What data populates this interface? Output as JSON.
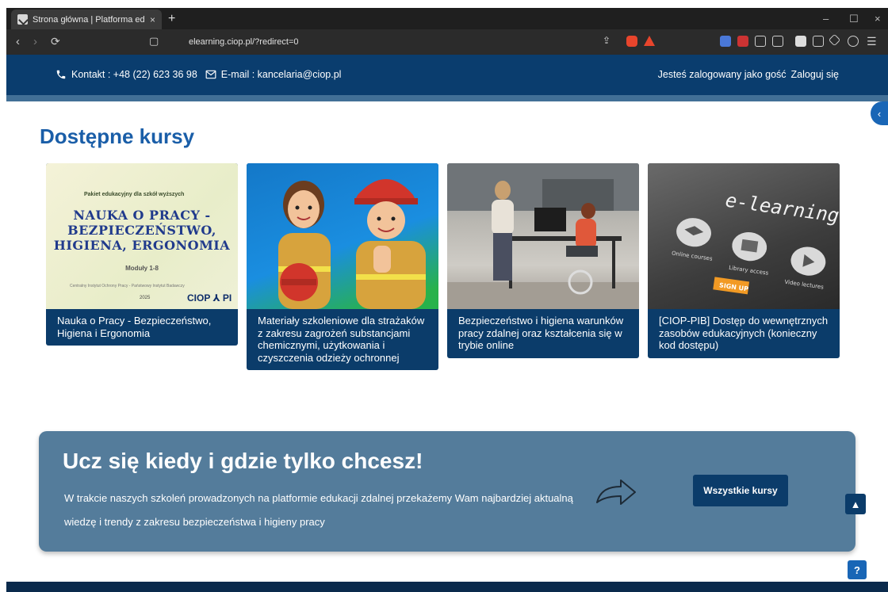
{
  "browser": {
    "tab_title": "Strona główna | Platforma edukac",
    "tab_close": "×",
    "new_tab": "+",
    "url": "elearning.ciop.pl/?redirect=0",
    "window_controls": [
      "–",
      "☐",
      "×"
    ]
  },
  "topbar": {
    "contact": "Kontakt : +48 (22) 623 36 98",
    "email": "E-mail : kancelaria@ciop.pl",
    "user_status": "Jesteś zalogowany jako gość",
    "login_link": "Zaloguj się"
  },
  "main": {
    "heading": "Dostępne kursy",
    "courses": [
      {
        "title": "Nauka o Pracy - Bezpieczeństwo, Higiena i Ergonomia"
      },
      {
        "title": "Materiały szkoleniowe dla strażaków z zakresu zagrożeń substancjami chemicznymi, użytkowania i czyszczenia odzieży ochronnej"
      },
      {
        "title": "Bezpieczeństwo i higiena warunków pracy zdalnej oraz kształcenia się w trybie online"
      },
      {
        "title": "[CIOP-PIB] Dostęp do wewnętrznych zasobów edukacyjnych (konieczny kod dostępu)"
      }
    ],
    "course1_image": {
      "kicker": "Pakiet edukacyjny dla szkół wyższych",
      "line1": "NAUKA O PRACY -",
      "line2": "BEZPIECZEŃSTWO,",
      "line3": "HIGIENA, ERGONOMIA",
      "modules": "Moduły 1-8",
      "publisher": "Centralny Instytut Ochrony Pracy - Państwowy Instytut Badawczy",
      "year": "2025",
      "logo": "CIOP ⅄ PI"
    },
    "course4_image": {
      "title": "e-learning",
      "online": "Online courses",
      "library": "Library access",
      "video": "Video lectures",
      "signup": "SIGN UP"
    }
  },
  "banner": {
    "heading": "Ucz się kiedy i gdzie tylko chcesz!",
    "text": "W trakcie naszych szkoleń prowadzonych na platformie edukacji zdalnej przekażemy Wam najbardziej aktualną wiedzę i trendy z zakresu bezpieczeństwa i higieny pracy",
    "button": "Wszystkie kursy"
  },
  "floating": {
    "scroll_up": "▲",
    "help": "?",
    "drawer": "‹"
  },
  "colors": {
    "primary_dark": "#0b3c6a",
    "heading_blue": "#1a5ea8",
    "banner": "#547c9b",
    "accent_blue": "#1966b6"
  }
}
